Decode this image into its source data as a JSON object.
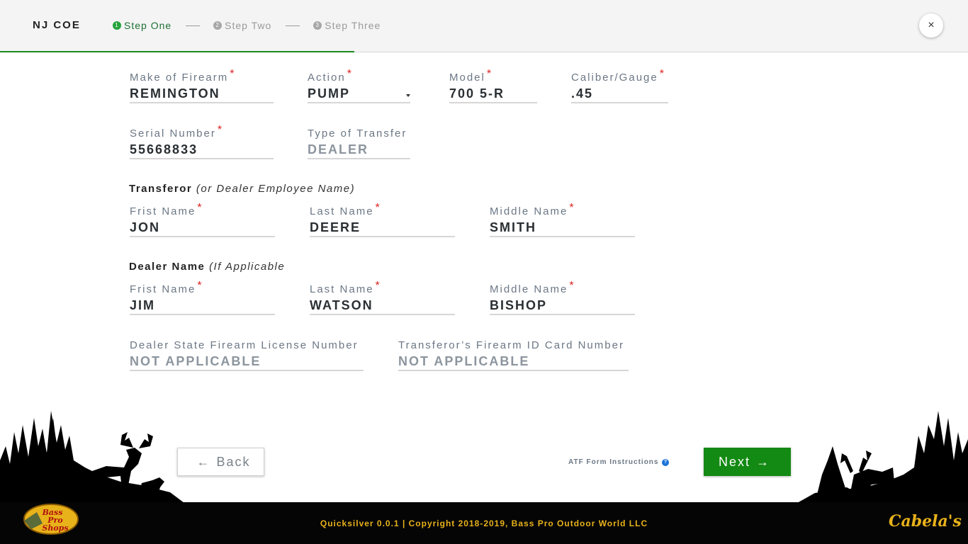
{
  "header": {
    "brand": "NJ COE",
    "steps": [
      {
        "num": "1",
        "label": "Step One",
        "active": true
      },
      {
        "num": "2",
        "label": "Step Two",
        "active": false
      },
      {
        "num": "3",
        "label": "Step Three",
        "active": false
      }
    ],
    "close_icon": "×"
  },
  "firearm": {
    "make": {
      "label": "Make of Firearm",
      "value": "REMINGTON"
    },
    "action": {
      "label": "Action",
      "value": "PUMP"
    },
    "model": {
      "label": "Model",
      "value": "700 5-R"
    },
    "caliber": {
      "label": "Caliber/Gauge",
      "value": ".45"
    },
    "serial": {
      "label": "Serial Number",
      "value": "55668833"
    },
    "transfer_type": {
      "label": "Type of Transfer",
      "value": "DEALER"
    }
  },
  "transferor": {
    "title": "Transferor",
    "note": "(or Dealer Employee Name)",
    "first": {
      "label": "Frist Name",
      "value": "JON"
    },
    "last": {
      "label": "Last Name",
      "value": "DEERE"
    },
    "middle": {
      "label": "Middle Name",
      "value": "SMITH"
    }
  },
  "dealer": {
    "title": "Dealer Name",
    "note": "(If Applicable",
    "first": {
      "label": "Frist Name",
      "value": "JIM"
    },
    "last": {
      "label": "Last Name",
      "value": "WATSON"
    },
    "middle": {
      "label": "Middle Name",
      "value": "BISHOP"
    }
  },
  "licenses": {
    "dealer_license": {
      "label": "Dealer State Firearm License Number",
      "value": "NOT APPLICABLE"
    },
    "transferor_id": {
      "label": "Transferor’s Firearm ID Card Number",
      "value": "NOT APPLICABLE"
    }
  },
  "required_mark": "*",
  "actions": {
    "back_label": "Back",
    "next_label": "Next",
    "atf_link": "ATF Form Instructions",
    "help_icon": "?"
  },
  "footer": {
    "copyright": "Quicksilver 0.0.1 | Copyright 2018-2019, Bass Pro Outdoor World LLC",
    "bass_pro_logo": "Bass Pro Shops",
    "cabelas_logo": "Cabela's"
  },
  "colors": {
    "accent_green": "#138a13",
    "required_red": "#dd2222",
    "footer_gold": "#e8b21a"
  }
}
